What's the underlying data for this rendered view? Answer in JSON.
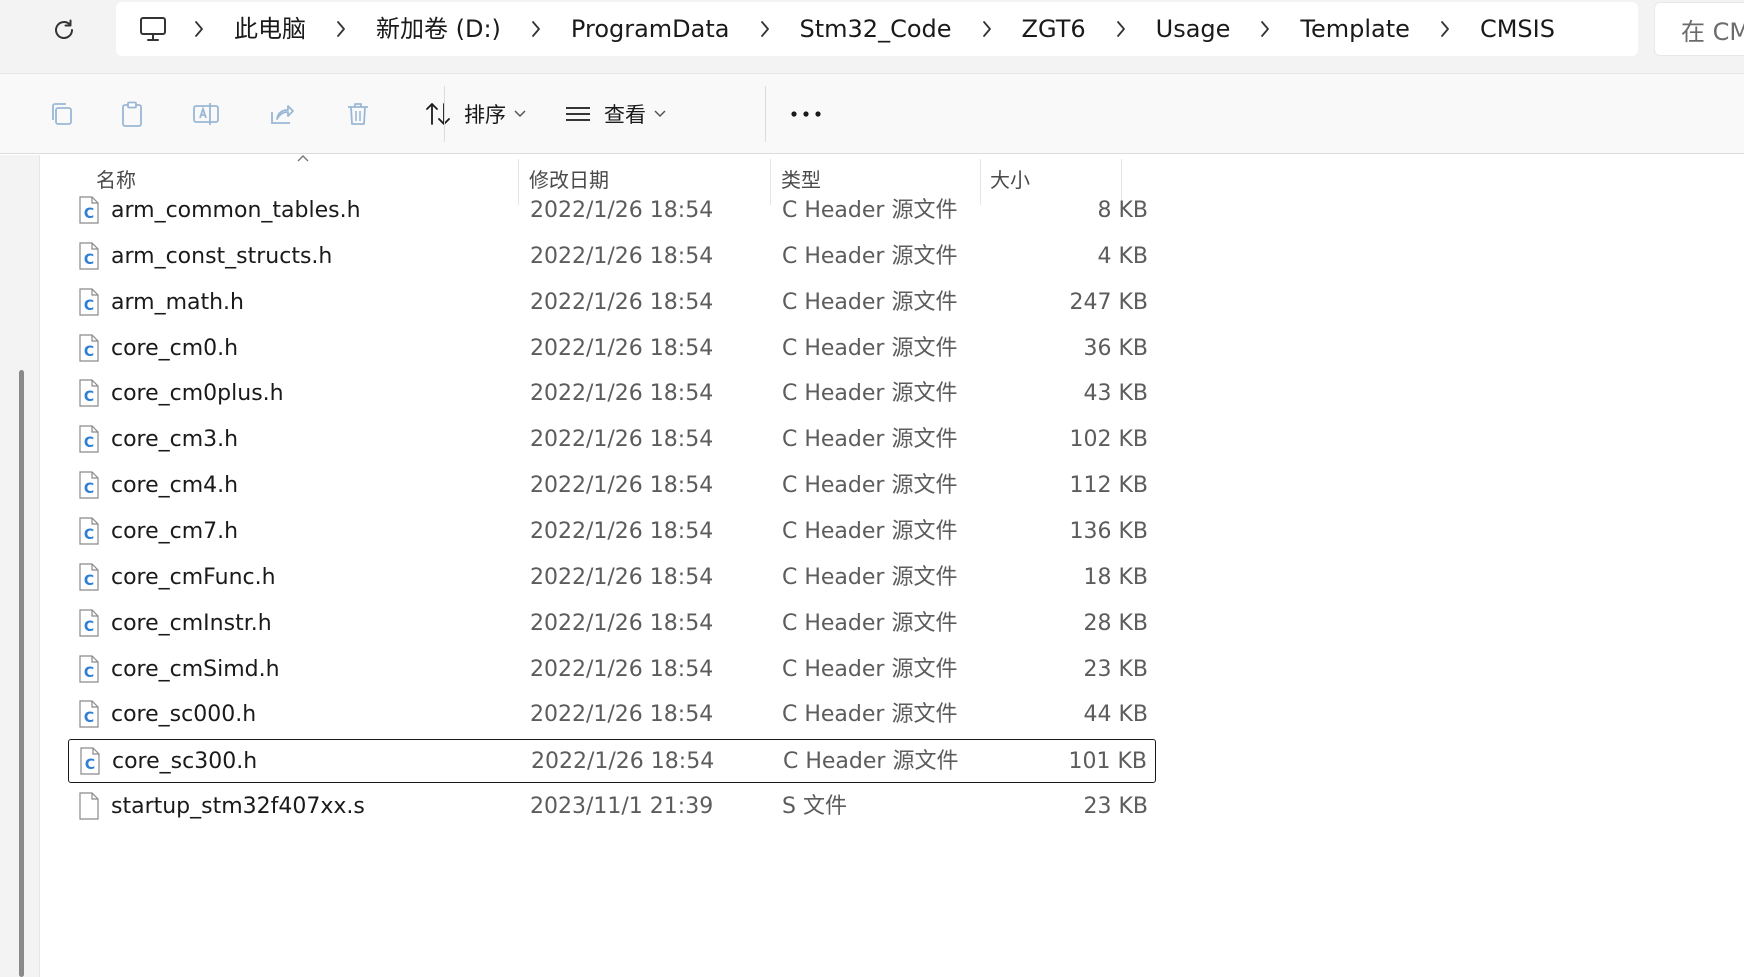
{
  "address": {
    "breadcrumbs": [
      "此电脑",
      "新加卷 (D:)",
      "ProgramData",
      "Stm32_Code",
      "ZGT6",
      "Usage",
      "Template",
      "CMSIS"
    ],
    "search_placeholder": "在 CMSIS 中搜索"
  },
  "toolbar": {
    "sort_label": "排序",
    "view_label": "查看"
  },
  "columns": {
    "name": "名称",
    "date": "修改日期",
    "type": "类型",
    "size": "大小"
  },
  "files": [
    {
      "name": "arm_common_tables.h",
      "date": "2022/1/26 18:54",
      "type": "C Header 源文件",
      "size": "8 KB",
      "icon": "c-header-file-icon"
    },
    {
      "name": "arm_const_structs.h",
      "date": "2022/1/26 18:54",
      "type": "C Header 源文件",
      "size": "4 KB",
      "icon": "c-header-file-icon"
    },
    {
      "name": "arm_math.h",
      "date": "2022/1/26 18:54",
      "type": "C Header 源文件",
      "size": "247 KB",
      "icon": "c-header-file-icon"
    },
    {
      "name": "core_cm0.h",
      "date": "2022/1/26 18:54",
      "type": "C Header 源文件",
      "size": "36 KB",
      "icon": "c-header-file-icon"
    },
    {
      "name": "core_cm0plus.h",
      "date": "2022/1/26 18:54",
      "type": "C Header 源文件",
      "size": "43 KB",
      "icon": "c-header-file-icon"
    },
    {
      "name": "core_cm3.h",
      "date": "2022/1/26 18:54",
      "type": "C Header 源文件",
      "size": "102 KB",
      "icon": "c-header-file-icon"
    },
    {
      "name": "core_cm4.h",
      "date": "2022/1/26 18:54",
      "type": "C Header 源文件",
      "size": "112 KB",
      "icon": "c-header-file-icon"
    },
    {
      "name": "core_cm7.h",
      "date": "2022/1/26 18:54",
      "type": "C Header 源文件",
      "size": "136 KB",
      "icon": "c-header-file-icon"
    },
    {
      "name": "core_cmFunc.h",
      "date": "2022/1/26 18:54",
      "type": "C Header 源文件",
      "size": "18 KB",
      "icon": "c-header-file-icon"
    },
    {
      "name": "core_cmInstr.h",
      "date": "2022/1/26 18:54",
      "type": "C Header 源文件",
      "size": "28 KB",
      "icon": "c-header-file-icon"
    },
    {
      "name": "core_cmSimd.h",
      "date": "2022/1/26 18:54",
      "type": "C Header 源文件",
      "size": "23 KB",
      "icon": "c-header-file-icon"
    },
    {
      "name": "core_sc000.h",
      "date": "2022/1/26 18:54",
      "type": "C Header 源文件",
      "size": "44 KB",
      "icon": "c-header-file-icon"
    },
    {
      "name": "core_sc300.h",
      "date": "2022/1/26 18:54",
      "type": "C Header 源文件",
      "size": "101 KB",
      "icon": "c-header-file-icon",
      "selected": true
    },
    {
      "name": "startup_stm32f407xx.s",
      "date": "2023/11/1 21:39",
      "type": "S 文件",
      "size": "23 KB",
      "icon": "blank-file-icon"
    }
  ],
  "colors": {
    "c_icon_blue": "#2f7fd6",
    "toolbar_icon_disabled": "#9ab8d6",
    "accent": "#0067c0"
  }
}
